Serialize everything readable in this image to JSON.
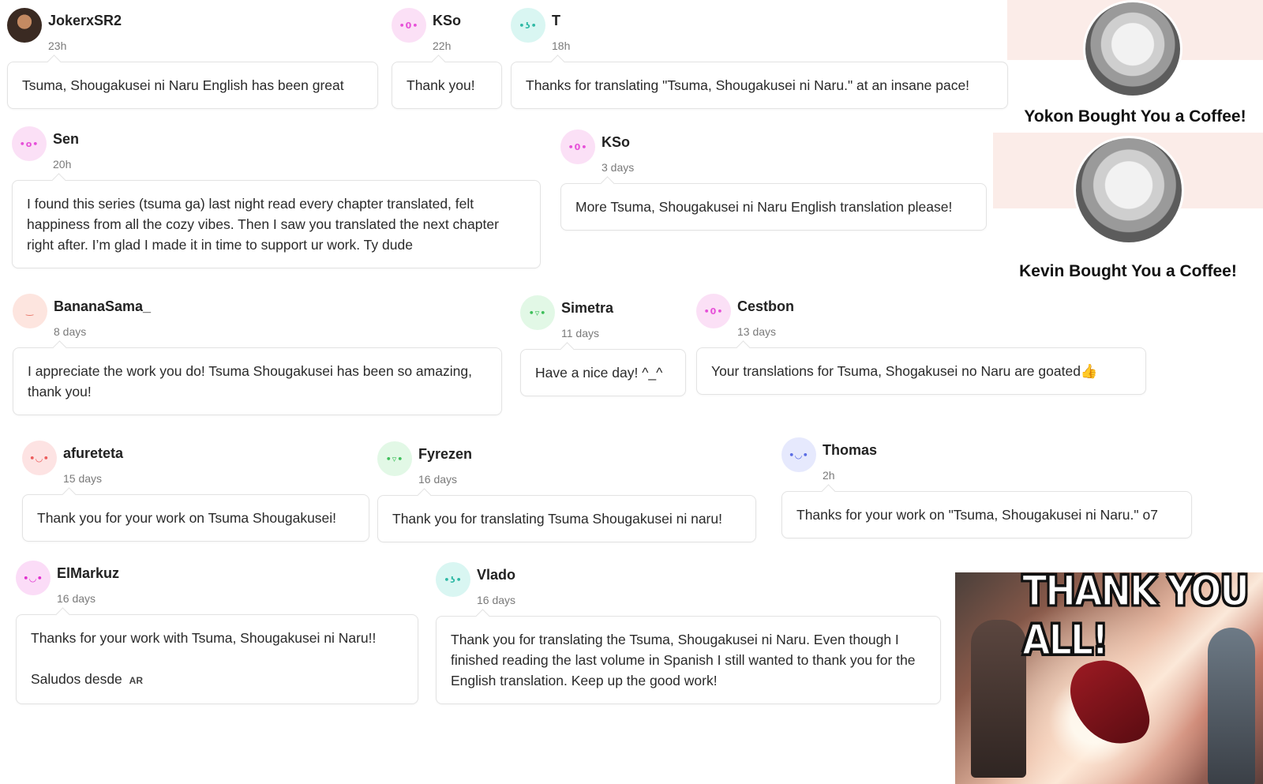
{
  "comments": [
    {
      "user": "JokerxSR2",
      "time": "23h",
      "text": "Tsuma, Shougakusei ni Naru English has been great"
    },
    {
      "user": "KSo",
      "time": "22h",
      "text": "Thank you!",
      "avatar_face": "•0•",
      "avatar_color": "#fbe0f6",
      "face_color": "#e64fd8"
    },
    {
      "user": "T",
      "time": "18h",
      "text": "Thanks for translating \"Tsuma, Shougakusei ni Naru.\" at an insane pace!",
      "avatar_face": "•ʖ•",
      "avatar_color": "#d9f6f2",
      "face_color": "#2fb9a5"
    },
    {
      "user": "Sen",
      "time": "20h",
      "text": "I found this series (tsuma ga) last night read every chapter translated, felt happiness from all the cozy vibes. Then I saw you translated the next chapter right after. I’m glad I made it in time to support ur work. Ty dude",
      "avatar_face": "•o•",
      "avatar_color": "#fbe0f6",
      "face_color": "#e64fd8"
    },
    {
      "user": "KSo",
      "time": "3 days",
      "text": "More Tsuma, Shougakusei ni Naru English translation please!",
      "avatar_face": "•0•",
      "avatar_color": "#fbe0f6",
      "face_color": "#e64fd8"
    },
    {
      "user": "BananaSama_",
      "time": "8 days",
      "text": "I appreciate the work you do! Tsuma Shougakusei has been so amazing, thank you!",
      "avatar_face": "‿",
      "avatar_color": "#fde5df",
      "face_color": "#e8776a"
    },
    {
      "user": "Simetra",
      "time": "11 days",
      "text": "Have a nice day! ^_^",
      "avatar_face": "•▿•",
      "avatar_color": "#e2f8e6",
      "face_color": "#3ebf5a"
    },
    {
      "user": "Cestbon",
      "time": "13 days",
      "text": "Your translations for Tsuma, Shogakusei no Naru are goated👍",
      "avatar_face": "•0•",
      "avatar_color": "#fbe0f6",
      "face_color": "#e64fd8"
    },
    {
      "user": "afureteta",
      "time": "15 days",
      "text": "Thank you for your work on Tsuma Shougakusei!",
      "avatar_face": "•◡•",
      "avatar_color": "#fde3e3",
      "face_color": "#ec5c5c"
    },
    {
      "user": "Fyrezen",
      "time": "16 days",
      "text": "Thank you for translating Tsuma Shougakusei ni naru!",
      "avatar_face": "•▿•",
      "avatar_color": "#e2f8e6",
      "face_color": "#3ebf5a"
    },
    {
      "user": "Thomas",
      "time": "2h",
      "text": "Thanks for your work on \"Tsuma, Shougakusei ni Naru.\" o7",
      "avatar_face": "•◡•",
      "avatar_color": "#e6e9fd",
      "face_color": "#5a6ce4"
    },
    {
      "user": "ElMarkuz",
      "time": "16 days",
      "text": "Thanks for your work with Tsuma, Shougakusei ni Naru!!",
      "text2": "Saludos desde",
      "flag": "AR",
      "avatar_face": "•◡•",
      "avatar_color": "#fbdcf7",
      "face_color": "#e02fce"
    },
    {
      "user": "Vlado",
      "time": "16 days",
      "text": "Thank you for translating the Tsuma, Shougakusei ni Naru. Even though I finished reading the last volume in Spanish I still wanted to thank you for the English translation. Keep up the good work!",
      "avatar_face": "•ʖ•",
      "avatar_color": "#d9f6f2",
      "face_color": "#2fb9a5"
    }
  ],
  "coffee": [
    {
      "title": "Yokon Bought You a Coffee!"
    },
    {
      "title": "Kevin Bought You a Coffee!"
    }
  ],
  "banner": {
    "caption": "THANK YOU ALL!"
  }
}
